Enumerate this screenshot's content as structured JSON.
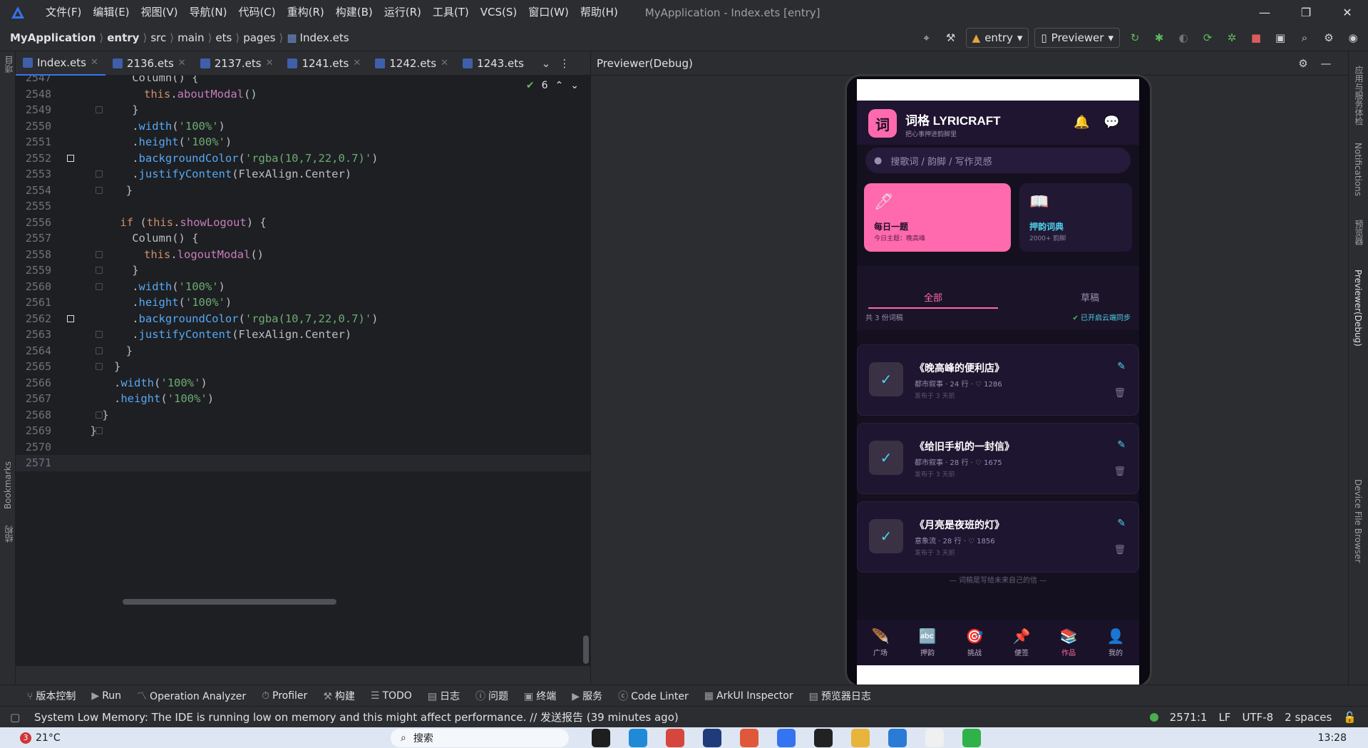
{
  "titlebar": {
    "menus": [
      "文件(F)",
      "编辑(E)",
      "视图(V)",
      "导航(N)",
      "代码(C)",
      "重构(R)",
      "构建(B)",
      "运行(R)",
      "工具(T)",
      "VCS(S)",
      "窗口(W)",
      "帮助(H)"
    ],
    "window_title": "MyApplication - Index.ets [entry]"
  },
  "breadcrumb": {
    "project": "MyApplication",
    "module": "entry",
    "parts": [
      "src",
      "main",
      "ets",
      "pages"
    ],
    "file": "Index.ets"
  },
  "toolbar": {
    "module_select": "entry",
    "device_select": "Previewer"
  },
  "editor": {
    "tabs": [
      "Index.ets",
      "2136.ets",
      "2137.ets",
      "1241.ets",
      "1242.ets",
      "1243.ets"
    ],
    "inspection_count": "6",
    "lines": [
      {
        "n": "2547",
        "text": "Column() {"
      },
      {
        "n": "2548",
        "text": "this.aboutModal()"
      },
      {
        "n": "2549",
        "text": "}"
      },
      {
        "n": "2550",
        "text": ".width('100%')"
      },
      {
        "n": "2551",
        "text": ".height('100%')"
      },
      {
        "n": "2552",
        "text": ".backgroundColor('rgba(10,7,22,0.7)')"
      },
      {
        "n": "2553",
        "text": ".justifyContent(FlexAlign.Center)"
      },
      {
        "n": "2554",
        "text": "}"
      },
      {
        "n": "2555",
        "text": ""
      },
      {
        "n": "2556",
        "text": "if (this.showLogout) {"
      },
      {
        "n": "2557",
        "text": "Column() {"
      },
      {
        "n": "2558",
        "text": "this.logoutModal()"
      },
      {
        "n": "2559",
        "text": "}"
      },
      {
        "n": "2560",
        "text": ".width('100%')"
      },
      {
        "n": "2561",
        "text": ".height('100%')"
      },
      {
        "n": "2562",
        "text": ".backgroundColor('rgba(10,7,22,0.7)')"
      },
      {
        "n": "2563",
        "text": ".justifyContent(FlexAlign.Center)"
      },
      {
        "n": "2564",
        "text": "}"
      },
      {
        "n": "2565",
        "text": "}"
      },
      {
        "n": "2566",
        "text": ".width('100%')"
      },
      {
        "n": "2567",
        "text": ".height('100%')"
      },
      {
        "n": "2568",
        "text": "}"
      },
      {
        "n": "2569",
        "text": "}"
      },
      {
        "n": "2570",
        "text": ""
      },
      {
        "n": "2571",
        "text": ""
      }
    ]
  },
  "previewer": {
    "title": "Previewer(Debug)"
  },
  "app": {
    "logo_char": "词",
    "name": "词格 LYRICRAFT",
    "subtitle": "把心事押进韵脚里",
    "search_placeholder": "搜歌词 / 韵脚 / 写作灵感",
    "cards": [
      {
        "title": "每日一题",
        "sub": "今日主题：晚高峰",
        "bg": "#ff6aae"
      },
      {
        "title": "押韵词典",
        "sub": "2000+ 韵脚",
        "bg": "#211834"
      }
    ],
    "tabs": [
      "全部",
      "草稿"
    ],
    "count_text": "共 3 份词稿",
    "sync_text": "已开启云端同步",
    "works": [
      {
        "title": "《晚高峰的便利店》",
        "meta": "都市叙事 · 24 行 · ♡ 1286",
        "date": "发布于 3 天前"
      },
      {
        "title": "《给旧手机的一封信》",
        "meta": "都市叙事 · 28 行 · ♡ 1675",
        "date": "发布于 3 天前"
      },
      {
        "title": "《月亮是夜班的灯》",
        "meta": "意象流 · 28 行 · ♡ 1856",
        "date": "发布于 3 天前"
      }
    ],
    "footer_note": "— 词稿是写给未来自己的信 —",
    "nav": [
      {
        "label": "广场",
        "icon": "🪶"
      },
      {
        "label": "押韵",
        "icon": "🔤"
      },
      {
        "label": "挑战",
        "icon": "🎯"
      },
      {
        "label": "便签",
        "icon": "📌"
      },
      {
        "label": "作品",
        "icon": "📚"
      },
      {
        "label": "我的",
        "icon": "👤"
      }
    ],
    "active_nav": 4,
    "accent": "#ff6aae",
    "cyan": "#4fd1e8"
  },
  "rightstrip": [
    "应用与服务体检",
    "Notifications",
    "预览器",
    "Previewer(Debug)",
    "Device File Browser"
  ],
  "leftstrip": [
    "项目",
    "Bookmarks",
    "结构"
  ],
  "toolwindows": [
    "版本控制",
    "Run",
    "Operation Analyzer",
    "Profiler",
    "构建",
    "TODO",
    "日志",
    "问题",
    "终端",
    "服务",
    "Code Linter",
    "ArkUI Inspector",
    "预览器日志"
  ],
  "statusbar": {
    "message": "System Low Memory: The IDE is running low on memory and this might affect performance. // 发送报告 (39 minutes ago)",
    "position": "2571:1",
    "line_sep": "LF",
    "encoding": "UTF-8",
    "indent": "2 spaces"
  },
  "taskbar": {
    "badge": "3",
    "temperature": "21°C",
    "search_label": "搜索",
    "time": "13:28"
  }
}
